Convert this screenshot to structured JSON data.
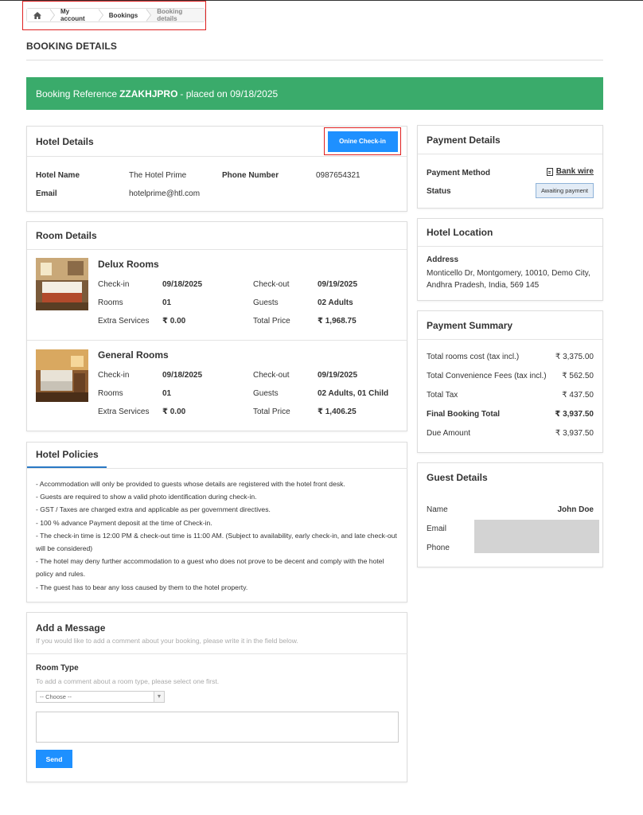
{
  "breadcrumb": {
    "items": [
      "My account",
      "Bookings",
      "Booking details"
    ]
  },
  "page": {
    "title": "BOOKING DETAILS"
  },
  "banner": {
    "prefix": "Booking Reference",
    "reference": "ZZAKHJPRO",
    "suffix": "- placed on 09/18/2025",
    "color": "#3aab6b"
  },
  "hotel": {
    "title": "Hotel Details",
    "checkin_button": "Onine Check-in",
    "name_label": "Hotel Name",
    "name": "The Hotel Prime",
    "phone_label": "Phone Number",
    "phone": "0987654321",
    "email_label": "Email",
    "email": "hotelprime@htl.com"
  },
  "rooms": {
    "title": "Room Details",
    "items": [
      {
        "name": "Delux Rooms",
        "checkin_label": "Check-in",
        "checkin": "09/18/2025",
        "checkout_label": "Check-out",
        "checkout": "09/19/2025",
        "rooms_label": "Rooms",
        "rooms": "01",
        "guests_label": "Guests",
        "guests": "02 Adults",
        "extra_label": "Extra Services",
        "extra": "₹ 0.00",
        "total_label": "Total Price",
        "total": "₹ 1,968.75"
      },
      {
        "name": "General Rooms",
        "checkin_label": "Check-in",
        "checkin": "09/18/2025",
        "checkout_label": "Check-out",
        "checkout": "09/19/2025",
        "rooms_label": "Rooms",
        "rooms": "01",
        "guests_label": "Guests",
        "guests": "02 Adults, 01 Child",
        "extra_label": "Extra Services",
        "extra": "₹ 0.00",
        "total_label": "Total Price",
        "total": "₹ 1,406.25"
      }
    ]
  },
  "policies": {
    "title": "Hotel Policies",
    "lines": [
      "- Accommodation will only be provided to guests whose details are registered with the hotel front desk.",
      "- Guests are required to show a valid photo identification during check-in.",
      "- GST / Taxes are charged extra and applicable as per government directives.",
      "- 100 % advance Payment deposit at the time of Check-in.",
      "- The check-in time is 12:00 PM & check-out time is 11:00 AM. (Subject to availability, early check-in, and late check-out will be considered)",
      "- The hotel may deny further accommodation to a guest who does not prove to be decent and comply with the hotel policy and rules.",
      "- The guest has to bear any loss caused by them to the hotel property."
    ]
  },
  "message": {
    "title": "Add a Message",
    "subtitle": "If you would like to add a comment about your booking, please write it in the field below.",
    "room_type_label": "Room Type",
    "room_type_hint": "To add a comment about a room type, please select one first.",
    "select_value": "-- Choose --",
    "send_label": "Send"
  },
  "payment_details": {
    "title": "Payment Details",
    "method_label": "Payment Method",
    "method": "Bank wire",
    "status_label": "Status",
    "status": "Awaiting payment"
  },
  "location": {
    "title": "Hotel Location",
    "address_label": "Address",
    "address_line1": "Monticello Dr, Montgomery, 10010, Demo City,",
    "address_line2": "Andhra Pradesh, India, 569 145"
  },
  "summary": {
    "title": "Payment Summary",
    "rows": [
      {
        "label": "Total rooms cost (tax incl.)",
        "value": "₹ 3,375.00"
      },
      {
        "label": "Total Convenience Fees (tax incl.)",
        "value": "₹ 562.50"
      },
      {
        "label": "Total Tax",
        "value": "₹ 437.50"
      },
      {
        "label": "Final Booking Total",
        "value": "₹ 3,937.50"
      },
      {
        "label": "Due Amount",
        "value": "₹ 3,937.50"
      }
    ]
  },
  "guest": {
    "title": "Guest Details",
    "name_label": "Name",
    "name": "John Doe",
    "email_label": "Email",
    "phone_label": "Phone"
  },
  "colors": {
    "accent": "#1e90ff",
    "success": "#3aab6b",
    "highlight": "#e02020"
  }
}
